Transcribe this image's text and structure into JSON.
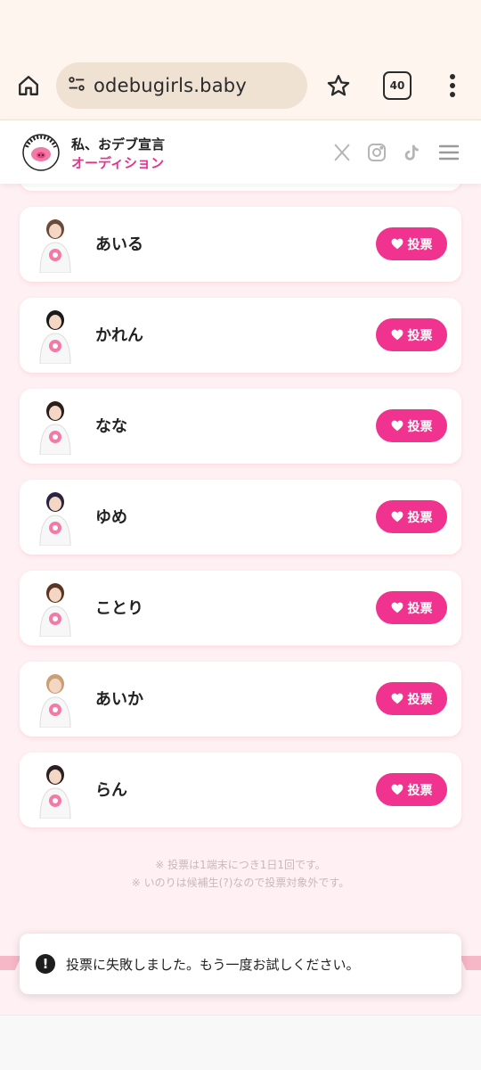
{
  "browser": {
    "url": "odebugirls.baby",
    "tab_count": "40"
  },
  "header": {
    "brand_line1": "私、おデブ宣言",
    "brand_line2": "オーディション",
    "logo_text": "私、おデブ宣言 オーディション"
  },
  "candidates": [
    {
      "name": "あいる",
      "vote_label": "投票",
      "hair": "#6b4a3a"
    },
    {
      "name": "かれん",
      "vote_label": "投票",
      "hair": "#1a1a1a"
    },
    {
      "name": "なな",
      "vote_label": "投票",
      "hair": "#2a1f1a"
    },
    {
      "name": "ゆめ",
      "vote_label": "投票",
      "hair": "#2b2440"
    },
    {
      "name": "ことり",
      "vote_label": "投票",
      "hair": "#5a3522"
    },
    {
      "name": "あいか",
      "vote_label": "投票",
      "hair": "#c9a074"
    },
    {
      "name": "らん",
      "vote_label": "投票",
      "hair": "#2a2020"
    }
  ],
  "notes": {
    "line1": "※ 投票は1端末につき1日1回です。",
    "line2": "※ いのりは候補生(?)なので投票対象外です。"
  },
  "toast": {
    "message": "投票に失敗しました。もう一度お試しください。"
  },
  "colors": {
    "accent": "#f0338f",
    "background": "#fff0f3",
    "brand_pink": "#e8318e"
  }
}
